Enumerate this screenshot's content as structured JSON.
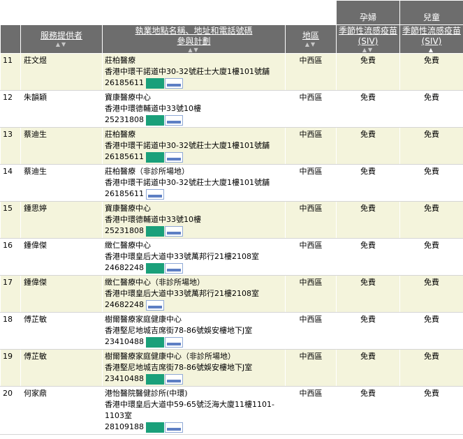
{
  "headers": {
    "group_pregnant": "孕婦",
    "group_children": "兒童",
    "provider": "服務提供者",
    "location_line1": "執業地點名稱、地址和電話號碼",
    "location_line2": "參與計劃",
    "district": "地區",
    "siv_pregnant": "季節性流感疫苗 (SIV)",
    "siv_children": "季節性流感疫苗 (SIV)",
    "sort_inactive": "▲▼",
    "sort_active": "▲"
  },
  "rows": [
    {
      "no": "11",
      "provider": "莊文煜",
      "clinic": "莊柏醫療",
      "address": "香港中環干諾道中30-32號莊士大廈1樓101號舖",
      "phone": "26185611",
      "badges": [
        "vaccination-voucher",
        "hk-gov"
      ],
      "district": "中西區",
      "pregnant": "免費",
      "children": "免費"
    },
    {
      "no": "12",
      "provider": "朱韻穎",
      "clinic": "寶康醫療中心",
      "address": "香港中環德輔道中33號10樓",
      "phone": "25231808",
      "badges": [
        "vaccination-voucher",
        "hk-gov"
      ],
      "district": "中西區",
      "pregnant": "免費",
      "children": "免費"
    },
    {
      "no": "13",
      "provider": "蔡迪生",
      "clinic": "莊柏醫療",
      "address": "香港中環干諾道中30-32號莊士大廈1樓101號舖",
      "phone": "26185611",
      "badges": [
        "vaccination-voucher",
        "hk-gov"
      ],
      "district": "中西區",
      "pregnant": "免費",
      "children": "免費"
    },
    {
      "no": "14",
      "provider": "蔡迪生",
      "clinic": "莊柏醫療（非診所場地）",
      "address": "香港中環干諾道中30-32號莊士大廈1樓101號舖",
      "phone": "26185611",
      "badges": [
        "hk-gov"
      ],
      "district": "中西區",
      "pregnant": "免費",
      "children": "免費"
    },
    {
      "no": "15",
      "provider": "鍾思婷",
      "clinic": "寶康醫療中心",
      "address": "香港中環德輔道中33號10樓",
      "phone": "25231808",
      "badges": [
        "vaccination-voucher",
        "hk-gov"
      ],
      "district": "中西區",
      "pregnant": "免費",
      "children": "免費"
    },
    {
      "no": "16",
      "provider": "鍾偉傑",
      "clinic": "緻仁醫療中心",
      "address": "香港中環皇后大道中33號萬邦行21樓2108室",
      "phone": "24682248",
      "badges": [
        "vaccination-voucher",
        "hk-gov"
      ],
      "district": "中西區",
      "pregnant": "免費",
      "children": "免費"
    },
    {
      "no": "17",
      "provider": "鍾偉傑",
      "clinic": "緻仁醫療中心（非診所場地）",
      "address": "香港中環皇后大道中33號萬邦行21樓2108室",
      "phone": "24682248",
      "badges": [
        "hk-gov"
      ],
      "district": "中西區",
      "pregnant": "免費",
      "children": "免費"
    },
    {
      "no": "18",
      "provider": "傅芷敏",
      "clinic": "樹爾醫療家庭健康中心",
      "address": "香港堅尼地城吉席街78-86號娛安樓地下J室",
      "phone": "23410488",
      "badges": [
        "vaccination-voucher",
        "hk-gov"
      ],
      "district": "中西區",
      "pregnant": "免費",
      "children": "免費"
    },
    {
      "no": "19",
      "provider": "傅芷敏",
      "clinic": "樹爾醫療家庭健康中心（非診所場地）",
      "address": "香港堅尼地城吉席街78-86號娛安樓地下J室",
      "phone": "23410488",
      "badges": [
        "vaccination-voucher",
        "hk-gov"
      ],
      "district": "中西區",
      "pregnant": "免費",
      "children": "免費"
    },
    {
      "no": "20",
      "provider": "何家鼎",
      "clinic": "港怡醫院醫健診所(中環)",
      "address": "香港中環皇后大道中59-65號泛海大廈11樓1101-1103室",
      "phone": "28109188",
      "badges": [
        "vaccination-voucher",
        "hk-gov"
      ],
      "district": "中西區",
      "pregnant": "免費",
      "children": "免費"
    }
  ]
}
